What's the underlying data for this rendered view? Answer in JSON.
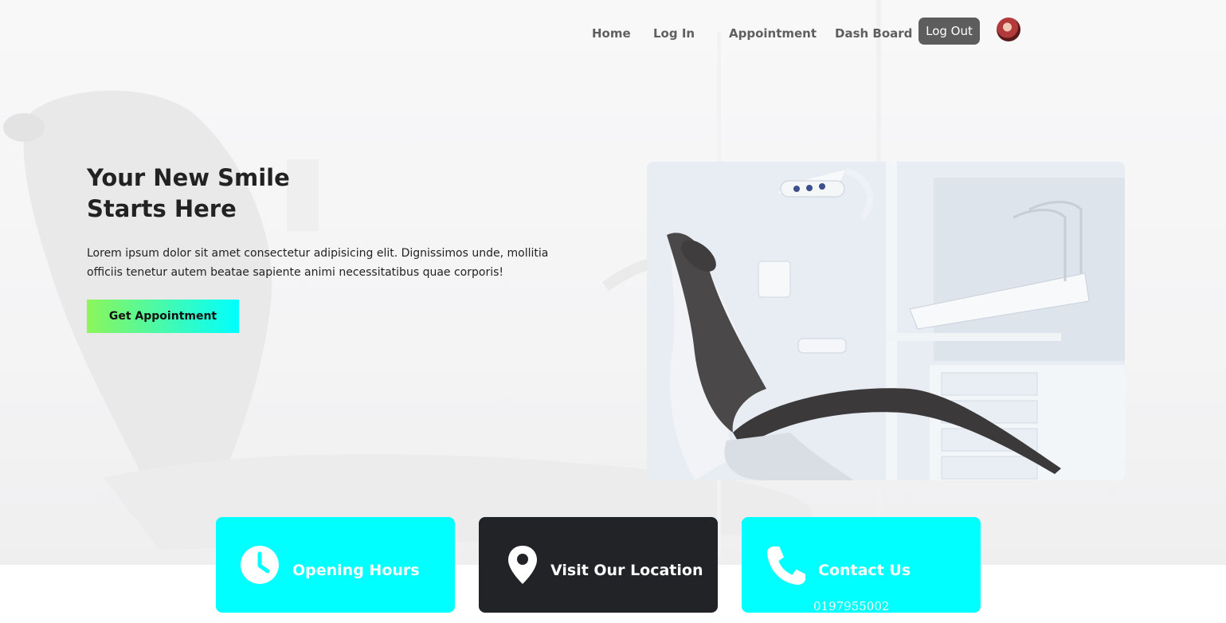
{
  "nav": {
    "home": "Home",
    "login": "Log In",
    "appointment": "Appointment",
    "dashboard": "Dash Board",
    "logout": "Log Out"
  },
  "hero": {
    "title_line1": "Your New Smile",
    "title_line2": "Starts Here",
    "description": "Lorem ipsum dolor sit amet consectetur adipisicing elit. Dignissimos unde, mollitia officiis tenetur autem beatae sapiente animi necessitatibus quae corporis!",
    "cta": "Get Appointment"
  },
  "cards": {
    "hours": {
      "title": "Opening Hours",
      "icon": "clock-icon"
    },
    "location": {
      "title": "Visit Our Location",
      "icon": "map-pin-icon"
    },
    "contact": {
      "title": "Contact Us",
      "icon": "phone-icon",
      "phone": "0197955002"
    }
  },
  "colors": {
    "accent_cyan": "#00ffff",
    "accent_green": "#8cf55a",
    "dark_card": "#212326",
    "logout_bg": "#5d5d5d",
    "nav_text": "#5f5f5f"
  }
}
